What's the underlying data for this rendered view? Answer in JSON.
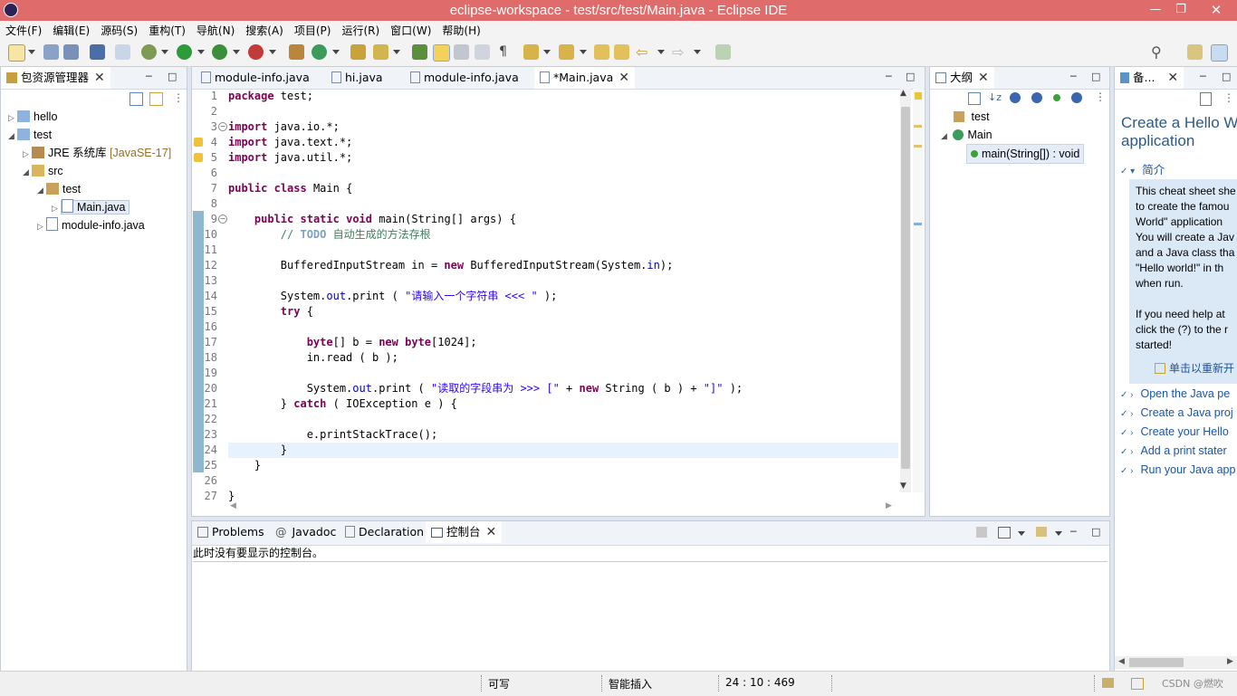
{
  "window": {
    "title": "eclipse-workspace - test/src/test/Main.java - Eclipse IDE"
  },
  "menu": [
    "文件(F)",
    "编辑(E)",
    "源码(S)",
    "重构(T)",
    "导航(N)",
    "搜索(A)",
    "项目(P)",
    "运行(R)",
    "窗口(W)",
    "帮助(H)"
  ],
  "package_explorer": {
    "tab_label": "包资源管理器",
    "tree": [
      {
        "label": "hello",
        "level": 0,
        "expanded": false,
        "icon": "project-icon"
      },
      {
        "label": "test",
        "level": 0,
        "expanded": true,
        "icon": "project-icon"
      },
      {
        "label": "JRE 系统库",
        "suffix": "[JavaSE-17]",
        "level": 1,
        "expanded": false,
        "icon": "library-icon"
      },
      {
        "label": "src",
        "level": 1,
        "expanded": true,
        "icon": "source-folder-icon"
      },
      {
        "label": "test",
        "level": 2,
        "expanded": true,
        "icon": "package-icon"
      },
      {
        "label": "Main.java",
        "level": 3,
        "expanded": false,
        "icon": "java-file-icon",
        "selected": true
      },
      {
        "label": "module-info.java",
        "level": 2,
        "expanded": false,
        "icon": "java-file-icon"
      }
    ]
  },
  "editor": {
    "tabs": [
      {
        "label": "module-info.java",
        "active": false
      },
      {
        "label": "hi.java",
        "active": false
      },
      {
        "label": "module-info.java",
        "active": false
      },
      {
        "label": "*Main.java",
        "active": true
      }
    ],
    "lines": [
      "package test;",
      "",
      "import java.io.*;",
      "import java.text.*;",
      "import java.util.*;",
      "",
      "public class Main {",
      "",
      "    public static void main(String[] args) {",
      "        // TODO 自动生成的方法存根",
      "",
      "        BufferedInputStream in = new BufferedInputStream(System.in);",
      "",
      "        System.out.print ( \"请输入一个字符串 <<< \" );",
      "        try {",
      "",
      "            byte[] b = new byte[1024];",
      "            in.read ( b );",
      "",
      "            System.out.print ( \"读取的字段串为 >>> [\" + new String ( b ) + \"]\" );",
      "        } catch ( IOException e ) {",
      "",
      "            e.printStackTrace();",
      "        }",
      "    }",
      "",
      "}"
    ]
  },
  "outline": {
    "tab_label": "大纲",
    "items": [
      {
        "label": "test",
        "level": 0
      },
      {
        "label": "Main",
        "level": 0
      },
      {
        "label": "main(String[]) : void",
        "level": 1
      }
    ]
  },
  "cheatsheet": {
    "tab_label": "备...",
    "title": "Create a Hello W application",
    "intro_label": "简介",
    "intro_lines": [
      "This cheat sheet she",
      "to create the famou",
      "World\" application",
      "You will create a Jav",
      "and a Java class tha",
      "\"Hello world!\" in th",
      "when run.",
      "",
      "If you need help at",
      "click the (?) to the r",
      "started!"
    ],
    "restart_link": "单击以重新开",
    "steps": [
      "Open the Java pe",
      "Create a Java proj",
      "Create your Hello",
      "Add a print stater",
      "Run your Java app"
    ]
  },
  "bottom_panel": {
    "tabs": [
      {
        "label": "Problems",
        "active": false
      },
      {
        "label": "Javadoc",
        "active": false
      },
      {
        "label": "Declaration",
        "active": false
      },
      {
        "label": "控制台",
        "active": true
      }
    ],
    "message": "此时没有要显示的控制台。"
  },
  "statusbar": {
    "writable": "可写",
    "insert_mode": "智能插入",
    "position": "24 : 10 : 469",
    "watermark": "CSDN @燃吹"
  }
}
